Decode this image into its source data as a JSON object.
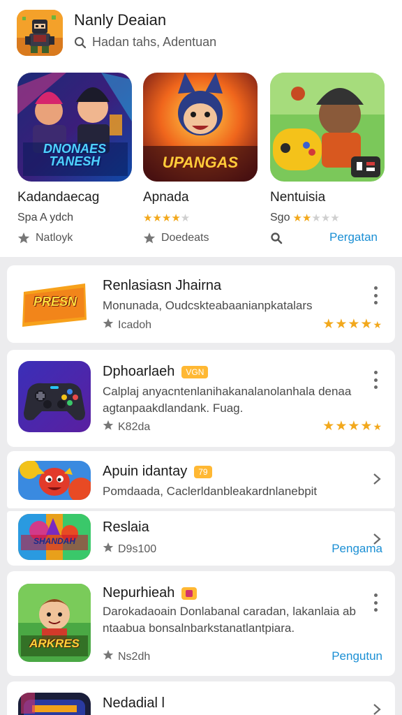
{
  "header": {
    "title": "Nanly Deaian",
    "search_text": "Hadan tahs, Adentuan"
  },
  "featured": [
    {
      "name": "Kadandaecag",
      "subtitle": "Spa A ydch",
      "meta": "Natloyk",
      "art_text": "DNONAES TANESH"
    },
    {
      "name": "Apnada",
      "rating": 4,
      "meta": "Doedeats",
      "art_text": "UPANGAS"
    },
    {
      "name": "Nentuisia",
      "subtitle": "Sgo",
      "rating": 2,
      "action": "Pergatan"
    }
  ],
  "list": [
    {
      "title": "Renlasiasn Jhairna",
      "desc": "Monunada, Oudcskteabaanianpkatalars",
      "meta": "Icadoh",
      "rating": 4,
      "art_text": "PRESN"
    },
    {
      "title": "Dphoarlaeh",
      "tag": "VGN",
      "desc": "Calplaj anyacntenlanihakanalanolanhala denaaagtanpaakdlandank. Fuag.",
      "meta": "K82da",
      "rating": 4
    },
    {
      "title": "Apuin idantay",
      "tag": "79",
      "desc": "Pomdaada, Caclerldanbleakardnlanebpit"
    },
    {
      "title": "Reslaia",
      "meta": "D9s100",
      "action": "Pengama",
      "art_text": "SHANDAH"
    },
    {
      "title": "Nepurhieah",
      "tag": "",
      "desc": "Darokadaoain Donlabanal caradan, lakanlaia abntaabua bonsalnbarkstanatlantpiara.",
      "meta": "Ns2dh",
      "action": "Pengutun",
      "art_text": "ARKRES"
    },
    {
      "title": "Nedadial l"
    }
  ]
}
